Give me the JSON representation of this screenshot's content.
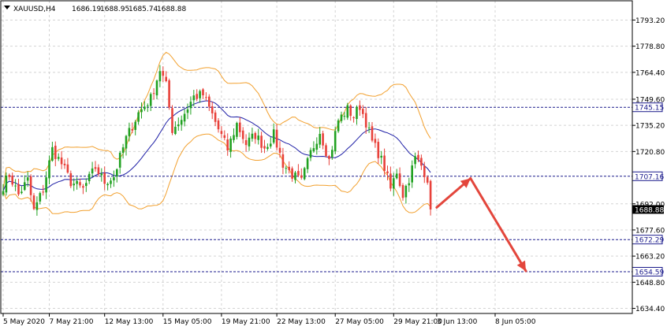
{
  "header": {
    "symbol": "XAUUSD,H4",
    "open": "1686.19",
    "high": "1688.95",
    "low": "1685.74",
    "close": "1688.88"
  },
  "colors": {
    "bull": "#21a121",
    "bear": "#e8413a",
    "bollinger": "#f2a02e",
    "ma": "#1d1ea6",
    "level_line": "#1b1b8c",
    "arrow": "#e3463c",
    "grid": "#d4d4d4",
    "axis": "#000000",
    "price_label_bg": "#000000"
  },
  "chart_data": {
    "type": "candlestick",
    "title": "",
    "x_tick_labels": [
      "5 May 2020",
      "7 May 21:00",
      "12 May 13:00",
      "15 May 05:00",
      "19 May 21:00",
      "22 May 13:00",
      "27 May 05:00",
      "29 May 21:00",
      "3 Jun 13:00",
      "8 Jun 05:00"
    ],
    "y_tick_labels": [
      "1793.20",
      "1778.80",
      "1764.40",
      "1749.60",
      "1735.20",
      "1720.80",
      "1692.00",
      "1677.60",
      "1663.20",
      "1648.80",
      "1634.40"
    ],
    "ylim": [
      1631.6,
      1803.8
    ],
    "grid": true,
    "levels": [
      {
        "label": "1745.15",
        "value": 1745.15
      },
      {
        "label": "1707.16",
        "value": 1707.16
      },
      {
        "label": "1672.29",
        "value": 1672.29
      },
      {
        "label": "1654.59",
        "value": 1654.59
      }
    ],
    "current_price_label": "1688.88",
    "current_price": 1688.88,
    "bar_count": 140,
    "tick_bar_index": [
      0,
      15,
      33,
      52,
      71,
      89,
      108,
      127,
      141,
      160
    ],
    "price_path": [
      [
        0,
        1702
      ],
      [
        2,
        1708
      ],
      [
        5,
        1697
      ],
      [
        8,
        1705
      ],
      [
        10,
        1688
      ],
      [
        13,
        1700
      ],
      [
        16,
        1722
      ],
      [
        19,
        1714
      ],
      [
        22,
        1704
      ],
      [
        26,
        1700
      ],
      [
        30,
        1712
      ],
      [
        33,
        1704
      ],
      [
        36,
        1707
      ],
      [
        40,
        1728
      ],
      [
        44,
        1742
      ],
      [
        48,
        1750
      ],
      [
        51,
        1766
      ],
      [
        53,
        1757
      ],
      [
        55,
        1733
      ],
      [
        58,
        1739
      ],
      [
        62,
        1751
      ],
      [
        65,
        1752
      ],
      [
        68,
        1741
      ],
      [
        70,
        1733
      ],
      [
        73,
        1722
      ],
      [
        76,
        1736
      ],
      [
        79,
        1725
      ],
      [
        82,
        1730
      ],
      [
        85,
        1723
      ],
      [
        88,
        1730
      ],
      [
        91,
        1714
      ],
      [
        94,
        1708
      ],
      [
        97,
        1704
      ],
      [
        100,
        1720
      ],
      [
        103,
        1732
      ],
      [
        106,
        1716
      ],
      [
        109,
        1738
      ],
      [
        112,
        1744
      ],
      [
        114,
        1740
      ],
      [
        116,
        1746
      ],
      [
        118,
        1737
      ],
      [
        120,
        1726
      ],
      [
        122,
        1720
      ],
      [
        124,
        1712
      ],
      [
        126,
        1700
      ],
      [
        128,
        1710
      ],
      [
        130,
        1697
      ],
      [
        132,
        1706
      ],
      [
        134,
        1717
      ],
      [
        136,
        1713
      ],
      [
        138,
        1706
      ],
      [
        139,
        1689
      ]
    ],
    "series": [
      {
        "name": "candles",
        "ohlc_from": "price_path"
      },
      {
        "name": "bollinger_upper"
      },
      {
        "name": "bollinger_lower"
      },
      {
        "name": "moving_average"
      }
    ],
    "annotations": {
      "forecast_path": [
        {
          "bar": 141,
          "price": 1690
        },
        {
          "bar": 152,
          "price": 1706
        },
        {
          "bar": 170,
          "price": 1655
        }
      ]
    }
  }
}
